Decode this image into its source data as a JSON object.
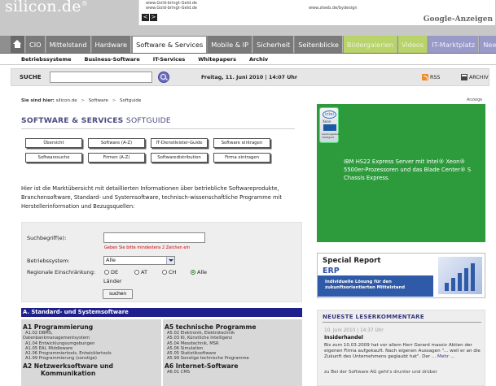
{
  "header": {
    "logo": "silicon.de",
    "ad": {
      "line1a": "www.Gold-bringt-Geld.de",
      "line1b": "www.Gold-bringt-Geld.de",
      "line2a": "",
      "line2b": "www.zteeb.de/bydesign",
      "nav_prev": "<",
      "nav_next": ">",
      "google_ads": "Google-Anzeigen"
    }
  },
  "mainnav": {
    "items": [
      {
        "label": "CIO"
      },
      {
        "label": "Mittelstand"
      },
      {
        "label": "Hardware"
      },
      {
        "label": "Software & Services"
      },
      {
        "label": "Mobile & IP"
      },
      {
        "label": "Sicherheit"
      },
      {
        "label": "Seitenblicke"
      },
      {
        "label": "Bildergalerien"
      },
      {
        "label": "Videos"
      },
      {
        "label": "IT-Marktplatz"
      },
      {
        "label": "Newsletter"
      }
    ],
    "active": "Software & Services"
  },
  "subnav": {
    "items": [
      "Betriebssysteme",
      "Business-Software",
      "IT-Services",
      "Whitepapers",
      "Archiv"
    ]
  },
  "searchbar": {
    "label": "SUCHE",
    "value": "",
    "date": "Freitag, 11. Juni 2010 | 14:07 Uhr",
    "rss": "RSS",
    "archiv": "ARCHIV"
  },
  "breadcrumb": {
    "prefix": "Sie sind hier:",
    "items": [
      "silicon.de",
      "Software",
      "Softguide"
    ]
  },
  "page": {
    "title_main": "SOFTWARE & SERVICES",
    "title_sub": "SOFTGUIDE",
    "buttons_row1": [
      "Übersicht",
      "Software (A-Z)",
      "IT-Dienstleister-Guide",
      "Software eintragen"
    ],
    "buttons_row2": [
      "Softwaresuche",
      "Firmen (A-Z)",
      "Softwaredistribution",
      "Firma eintragen"
    ],
    "intro": "Hier ist die Marktübersicht mit detaillierten Informationen über betriebliche Softwareprodukte, Branchensoftware, Standard- und Systemsoftware, technisch-wissenschaftliche Programme mit Herstellerinformation und Bezugsquellen:"
  },
  "form": {
    "term_label": "Suchbegriff(e):",
    "term_value": "",
    "term_hint": "Geben Sie bitte mindestens 2 Zeichen ein",
    "system_label": "Betriebssystem:",
    "system_value": "Alle",
    "region_label": "Regionale Einschränkung:",
    "region_options": [
      "DE",
      "AT",
      "CH",
      "Alle"
    ],
    "region_selected": "Alle",
    "region_extra": "Länder",
    "submit": "suchen"
  },
  "categories": {
    "header": "A. Standard- und Systemsoftware",
    "left": {
      "h1": "A1 Programmierung",
      "items1": [
        "A1.02 DBMS,",
        "Datenbankmanagementsystem",
        "A1.04 Entwicklungsumgebungen",
        "A1.05 EAI, Middleware",
        "A1.06 Programmiertools, Entwicklertools",
        "A1.99 Programmierung (sonstige)"
      ],
      "h2": "A2 Netzwerksoftware und",
      "h2b": "Kommunikation"
    },
    "right": {
      "h1": "A5 technische Programme",
      "items1": [
        "A5.02 Elektronik, Elektrotechnik",
        "A5.03 KI, Künstliche Intelligenz",
        "A5.04 Messtechnik, MSR",
        "A5.06 Simulation",
        "A5.05 Statistiksoftware",
        "A5.99 Sonstige technische Programme"
      ],
      "h2": "A6 Internet-Software",
      "items2": [
        "A6.01 CMS"
      ]
    }
  },
  "sidebar": {
    "anzeige": "Anzeige",
    "intel_ad": {
      "badge_logo": "intel",
      "badge_brand": "Xeon",
      "badge_caption": "Leistungsstark Intelligent",
      "text": "IBM HS22 Express Server mit Intel® Xeon® 5500er-Prozessoren und das Blade Center® S Chassis Express."
    },
    "special": {
      "title": "Special Report",
      "topic": "ERP",
      "subtitle": "Individuelle Lösung für den zukunftsorientierten Mittelstand"
    },
    "comments": {
      "title": "NEUESTE LESERKOMMENTARE",
      "stamp": "10. Juni 2010 | 14:37 Uhr",
      "entry_title": "Insiderhandel",
      "entry_body": "Bis zum 10.03.2009 hat vor allem Herr Gerard massiv Aktien der eigenen Firma aufgekauft. Nach eigenen Aussagen \"... weil er an die Zukunft des Unternehmens geglaubt hat\". Der ...",
      "mehr": "Mehr ...",
      "next": "zu Bei der Software AG geht's drunter und drüber"
    }
  },
  "colors": {
    "nav_bg": "#8f8f8f",
    "title": "#4b4b82",
    "category_header": "#20208c",
    "ad_green": "#2d9a3c",
    "erp_blue": "#2f5aa8"
  }
}
